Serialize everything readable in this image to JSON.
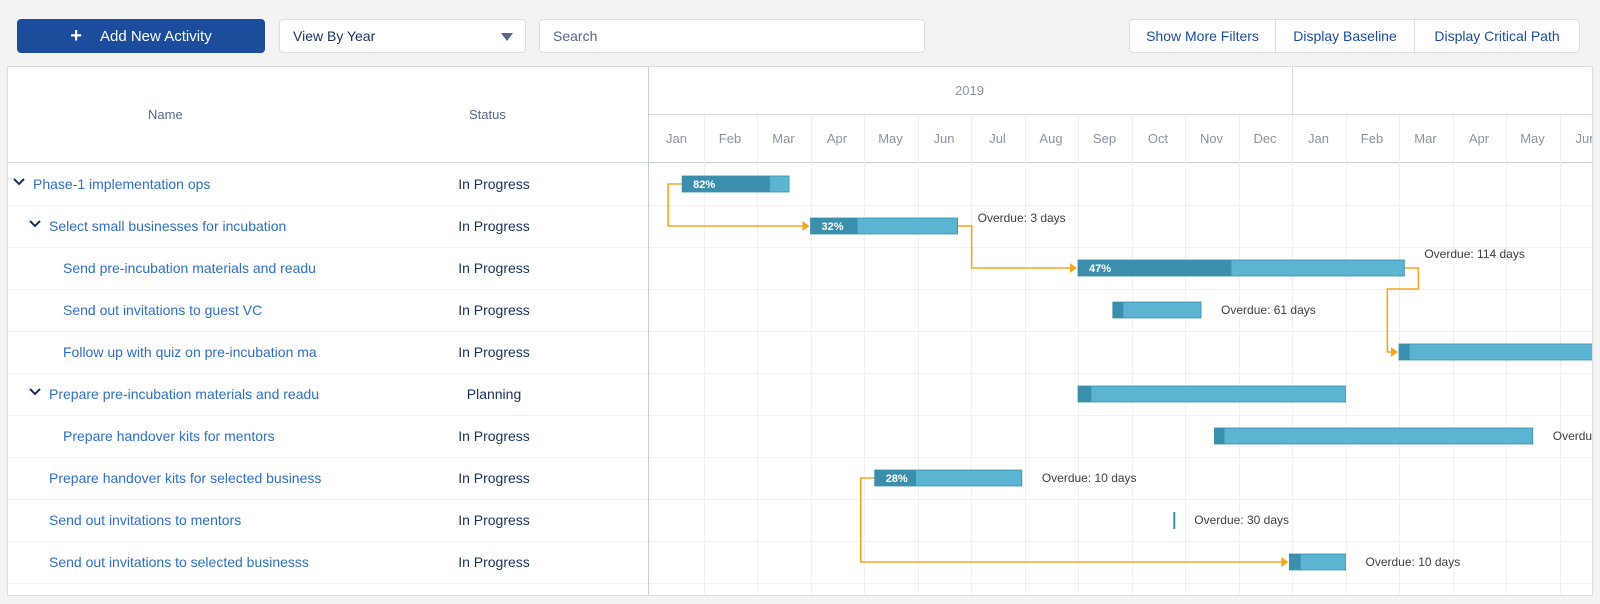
{
  "toolbar": {
    "add_label": "Add New Activity",
    "view_select": "View By Year",
    "search_placeholder": "Search",
    "filters_label": "Show More Filters",
    "baseline_label": "Display Baseline",
    "critical_label": "Display Critical Path"
  },
  "columns": {
    "name": "Name",
    "status": "Status"
  },
  "timeline": {
    "year": "2019",
    "months": [
      "Jan",
      "Feb",
      "Mar",
      "Apr",
      "May",
      "Jun",
      "Jul",
      "Aug",
      "Sep",
      "Oct",
      "Nov",
      "Dec",
      "Jan",
      "Feb",
      "Mar",
      "Apr",
      "May",
      "Jun"
    ]
  },
  "rows": [
    {
      "name": "Phase-1 implementation ops",
      "status": "In Progress",
      "level": 0,
      "expandable": true
    },
    {
      "name": "Select small businesses for incubation",
      "status": "In Progress",
      "level": 1,
      "expandable": true
    },
    {
      "name": "Send pre-incubation materials and readu",
      "status": "In Progress",
      "level": 2,
      "expandable": false
    },
    {
      "name": "Send out invitations to guest VC",
      "status": "In Progress",
      "level": 2,
      "expandable": false
    },
    {
      "name": "Follow up with quiz on pre-incubation ma",
      "status": "In Progress",
      "level": 2,
      "expandable": false
    },
    {
      "name": "Prepare pre-incubation materials and readu",
      "status": "Planning",
      "level": 1,
      "expandable": true
    },
    {
      "name": "Prepare handover kits for mentors",
      "status": "In Progress",
      "level": 2,
      "expandable": false
    },
    {
      "name": "Prepare handover kits for selected business",
      "status": "In Progress",
      "level": 1,
      "expandable": false
    },
    {
      "name": "Send out invitations to mentors",
      "status": "In Progress",
      "level": 1,
      "expandable": false
    },
    {
      "name": "Send out invitations to selected businesss",
      "status": "In Progress",
      "level": 1,
      "expandable": false
    }
  ],
  "bars": [
    {
      "row": 0,
      "start_month": 0.6,
      "end_month": 2.6,
      "progress": 0.82,
      "label": "82%",
      "note": ""
    },
    {
      "row": 1,
      "start_month": 3.0,
      "end_month": 5.75,
      "progress": 0.32,
      "label": "32%",
      "note": "Overdue: 3 days"
    },
    {
      "row": 2,
      "start_month": 8.0,
      "end_month": 14.1,
      "progress": 0.47,
      "label": "47%",
      "note": "Overdue: 114 days"
    },
    {
      "row": 3,
      "start_month": 8.65,
      "end_month": 10.3,
      "progress": 0.12,
      "label": "",
      "note": "Overdue: 61 days"
    },
    {
      "row": 4,
      "start_month": 14.0,
      "end_month": 18.0,
      "progress": 0.05,
      "label": "",
      "note": ""
    },
    {
      "row": 5,
      "start_month": 8.0,
      "end_month": 13.0,
      "progress": 0.05,
      "label": "",
      "note": ""
    },
    {
      "row": 6,
      "start_month": 10.55,
      "end_month": 16.5,
      "progress": 0.03,
      "label": "",
      "note": "Overdu"
    },
    {
      "row": 7,
      "start_month": 4.2,
      "end_month": 6.95,
      "progress": 0.28,
      "label": "28%",
      "note": "Overdue: 10 days"
    },
    {
      "row": 8,
      "start_month": 9.8,
      "end_month": 9.8,
      "progress": 0,
      "label": "",
      "note": "Overdue: 30 days"
    },
    {
      "row": 9,
      "start_month": 11.95,
      "end_month": 13.0,
      "progress": 0.2,
      "label": "",
      "note": "Overdue: 10 days"
    }
  ],
  "colors": {
    "bar": "#5ab4d2",
    "bar_progress": "#3b8fad",
    "dependency": "#f5a623",
    "link": "#2e6fc4",
    "primary": "#1b4d9c"
  }
}
